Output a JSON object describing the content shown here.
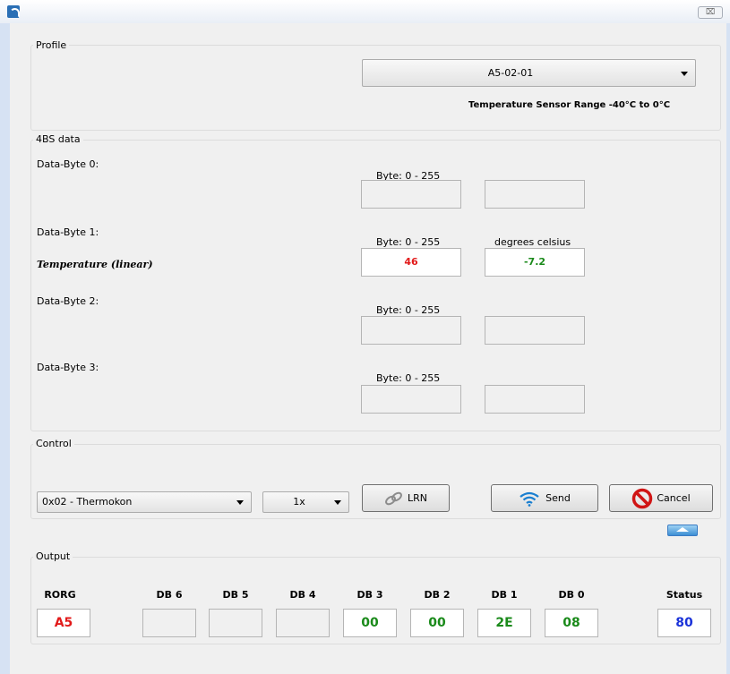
{
  "window": {
    "close_glyph": "⌧"
  },
  "profile": {
    "title": "Profile",
    "selected": "A5-02-01",
    "description": "Temperature Sensor Range -40°C to 0°C"
  },
  "data4bs": {
    "title": "4BS data",
    "bytes": [
      {
        "label": "Data-Byte 0:",
        "range_label": "Byte: 0 - 255",
        "sublabel": "",
        "unit_label": "",
        "raw": "",
        "value": ""
      },
      {
        "label": "Data-Byte 1:",
        "range_label": "Byte: 0 - 255",
        "sublabel": "Temperature (linear)",
        "unit_label": "degrees celsius",
        "raw": "46",
        "value": "-7.2"
      },
      {
        "label": "Data-Byte 2:",
        "range_label": "Byte: 0 - 255",
        "sublabel": "",
        "unit_label": "",
        "raw": "",
        "value": ""
      },
      {
        "label": "Data-Byte 3:",
        "range_label": "Byte: 0 - 255",
        "sublabel": "",
        "unit_label": "",
        "raw": "",
        "value": ""
      }
    ]
  },
  "control": {
    "title": "Control",
    "device": "0x02 - Thermokon",
    "repeat": "1x",
    "lrn_label": "LRN",
    "send_label": "Send",
    "cancel_label": "Cancel"
  },
  "output": {
    "title": "Output",
    "fields": [
      {
        "header": "RORG",
        "value": "A5",
        "color": "#e21a1a"
      },
      {
        "header": "DB 6",
        "value": "",
        "color": "#000000"
      },
      {
        "header": "DB 5",
        "value": "",
        "color": "#000000"
      },
      {
        "header": "DB 4",
        "value": "",
        "color": "#000000"
      },
      {
        "header": "DB 3",
        "value": "00",
        "color": "#1a8a1a"
      },
      {
        "header": "DB 2",
        "value": "00",
        "color": "#1a8a1a"
      },
      {
        "header": "DB 1",
        "value": "2E",
        "color": "#1a8a1a"
      },
      {
        "header": "DB 0",
        "value": "08",
        "color": "#1a8a1a"
      },
      {
        "header": "Status",
        "value": "80",
        "color": "#1a32d9"
      }
    ]
  },
  "colors": {
    "accent": "#2a6fb5",
    "value_red": "#e21a1a",
    "value_green": "#1a8a1a",
    "value_blue": "#1a32d9"
  },
  "icons": [
    "app-icon",
    "close-icon",
    "link-icon",
    "wifi-icon",
    "cancel-icon",
    "collapse-icon",
    "dropdown-icon"
  ]
}
